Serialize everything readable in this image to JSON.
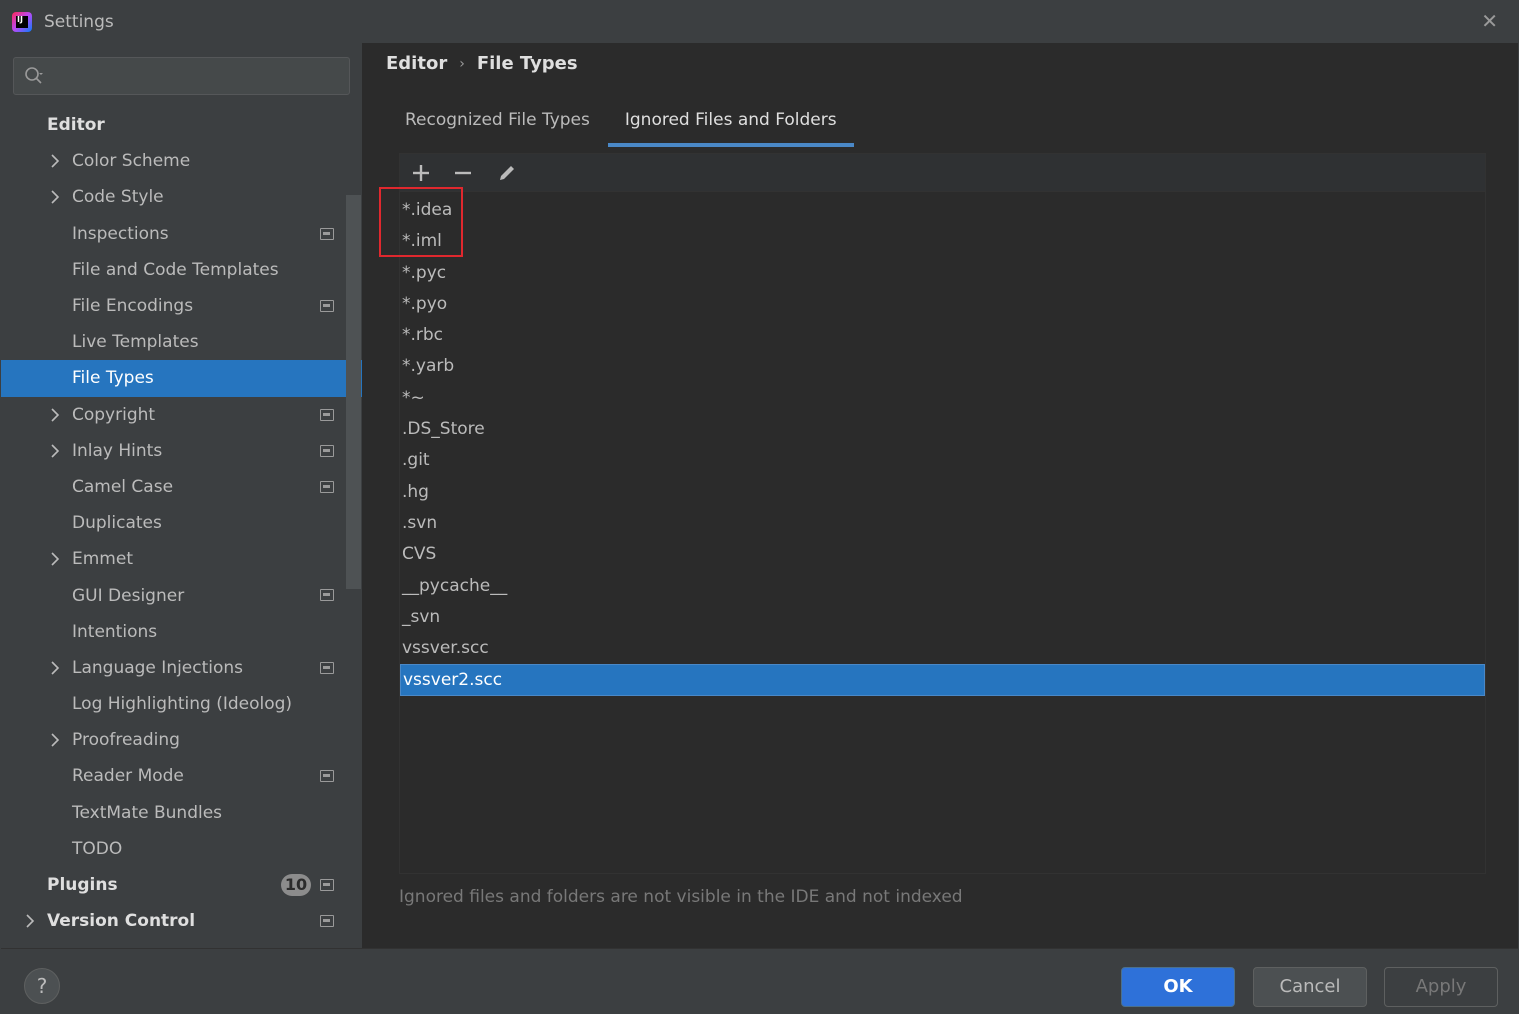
{
  "window": {
    "title": "Settings"
  },
  "search": {
    "placeholder": ""
  },
  "sidebar": {
    "items": [
      {
        "label": "Editor",
        "kind": "section",
        "indent": 0,
        "expandable": false,
        "project_icon": false
      },
      {
        "label": "Color Scheme",
        "kind": "item",
        "indent": 1,
        "expandable": true,
        "project_icon": false
      },
      {
        "label": "Code Style",
        "kind": "item",
        "indent": 1,
        "expandable": true,
        "project_icon": false
      },
      {
        "label": "Inspections",
        "kind": "item",
        "indent": 1,
        "expandable": false,
        "project_icon": true
      },
      {
        "label": "File and Code Templates",
        "kind": "item",
        "indent": 1,
        "expandable": false,
        "project_icon": false
      },
      {
        "label": "File Encodings",
        "kind": "item",
        "indent": 1,
        "expandable": false,
        "project_icon": true
      },
      {
        "label": "Live Templates",
        "kind": "item",
        "indent": 1,
        "expandable": false,
        "project_icon": false
      },
      {
        "label": "File Types",
        "kind": "item",
        "indent": 1,
        "expandable": false,
        "project_icon": false,
        "selected": true
      },
      {
        "label": "Copyright",
        "kind": "item",
        "indent": 1,
        "expandable": true,
        "project_icon": true
      },
      {
        "label": "Inlay Hints",
        "kind": "item",
        "indent": 1,
        "expandable": true,
        "project_icon": true
      },
      {
        "label": "Camel Case",
        "kind": "item",
        "indent": 1,
        "expandable": false,
        "project_icon": true
      },
      {
        "label": "Duplicates",
        "kind": "item",
        "indent": 1,
        "expandable": false,
        "project_icon": false
      },
      {
        "label": "Emmet",
        "kind": "item",
        "indent": 1,
        "expandable": true,
        "project_icon": false
      },
      {
        "label": "GUI Designer",
        "kind": "item",
        "indent": 1,
        "expandable": false,
        "project_icon": true
      },
      {
        "label": "Intentions",
        "kind": "item",
        "indent": 1,
        "expandable": false,
        "project_icon": false
      },
      {
        "label": "Language Injections",
        "kind": "item",
        "indent": 1,
        "expandable": true,
        "project_icon": true
      },
      {
        "label": "Log Highlighting (Ideolog)",
        "kind": "item",
        "indent": 1,
        "expandable": false,
        "project_icon": false
      },
      {
        "label": "Proofreading",
        "kind": "item",
        "indent": 1,
        "expandable": true,
        "project_icon": false
      },
      {
        "label": "Reader Mode",
        "kind": "item",
        "indent": 1,
        "expandable": false,
        "project_icon": true
      },
      {
        "label": "TextMate Bundles",
        "kind": "item",
        "indent": 1,
        "expandable": false,
        "project_icon": false
      },
      {
        "label": "TODO",
        "kind": "item",
        "indent": 1,
        "expandable": false,
        "project_icon": false
      },
      {
        "label": "Plugins",
        "kind": "section",
        "indent": 0,
        "expandable": false,
        "project_icon": true,
        "badge": "10"
      },
      {
        "label": "Version Control",
        "kind": "section",
        "indent": 0,
        "expandable": true,
        "project_icon": true
      }
    ]
  },
  "breadcrumb": {
    "parent": "Editor",
    "separator": "›",
    "current": "File Types"
  },
  "tabs": [
    {
      "label": "Recognized File Types",
      "active": false
    },
    {
      "label": "Ignored Files and Folders",
      "active": true
    }
  ],
  "toolbar": {
    "icons": [
      "add-icon",
      "remove-icon",
      "edit-icon"
    ]
  },
  "ignored_list": [
    {
      "label": "*.idea"
    },
    {
      "label": "*.iml"
    },
    {
      "label": "*.pyc"
    },
    {
      "label": "*.pyo"
    },
    {
      "label": "*.rbc"
    },
    {
      "label": "*.yarb"
    },
    {
      "label": "*~"
    },
    {
      "label": ".DS_Store"
    },
    {
      "label": ".git"
    },
    {
      "label": ".hg"
    },
    {
      "label": ".svn"
    },
    {
      "label": "CVS"
    },
    {
      "label": "__pycache__"
    },
    {
      "label": "_svn"
    },
    {
      "label": "vssver.scc"
    },
    {
      "label": "vssver2.scc",
      "selected": true
    }
  ],
  "hint": "Ignored files and folders are not visible in the IDE and not indexed",
  "footer": {
    "help_label": "?",
    "ok_label": "OK",
    "cancel_label": "Cancel",
    "apply_label": "Apply"
  },
  "colors": {
    "accent": "#2675bf",
    "ok_button": "#2e71d9",
    "highlight_box": "#e0282e",
    "background": "#2b2b2b",
    "panel": "#3c3f41"
  }
}
